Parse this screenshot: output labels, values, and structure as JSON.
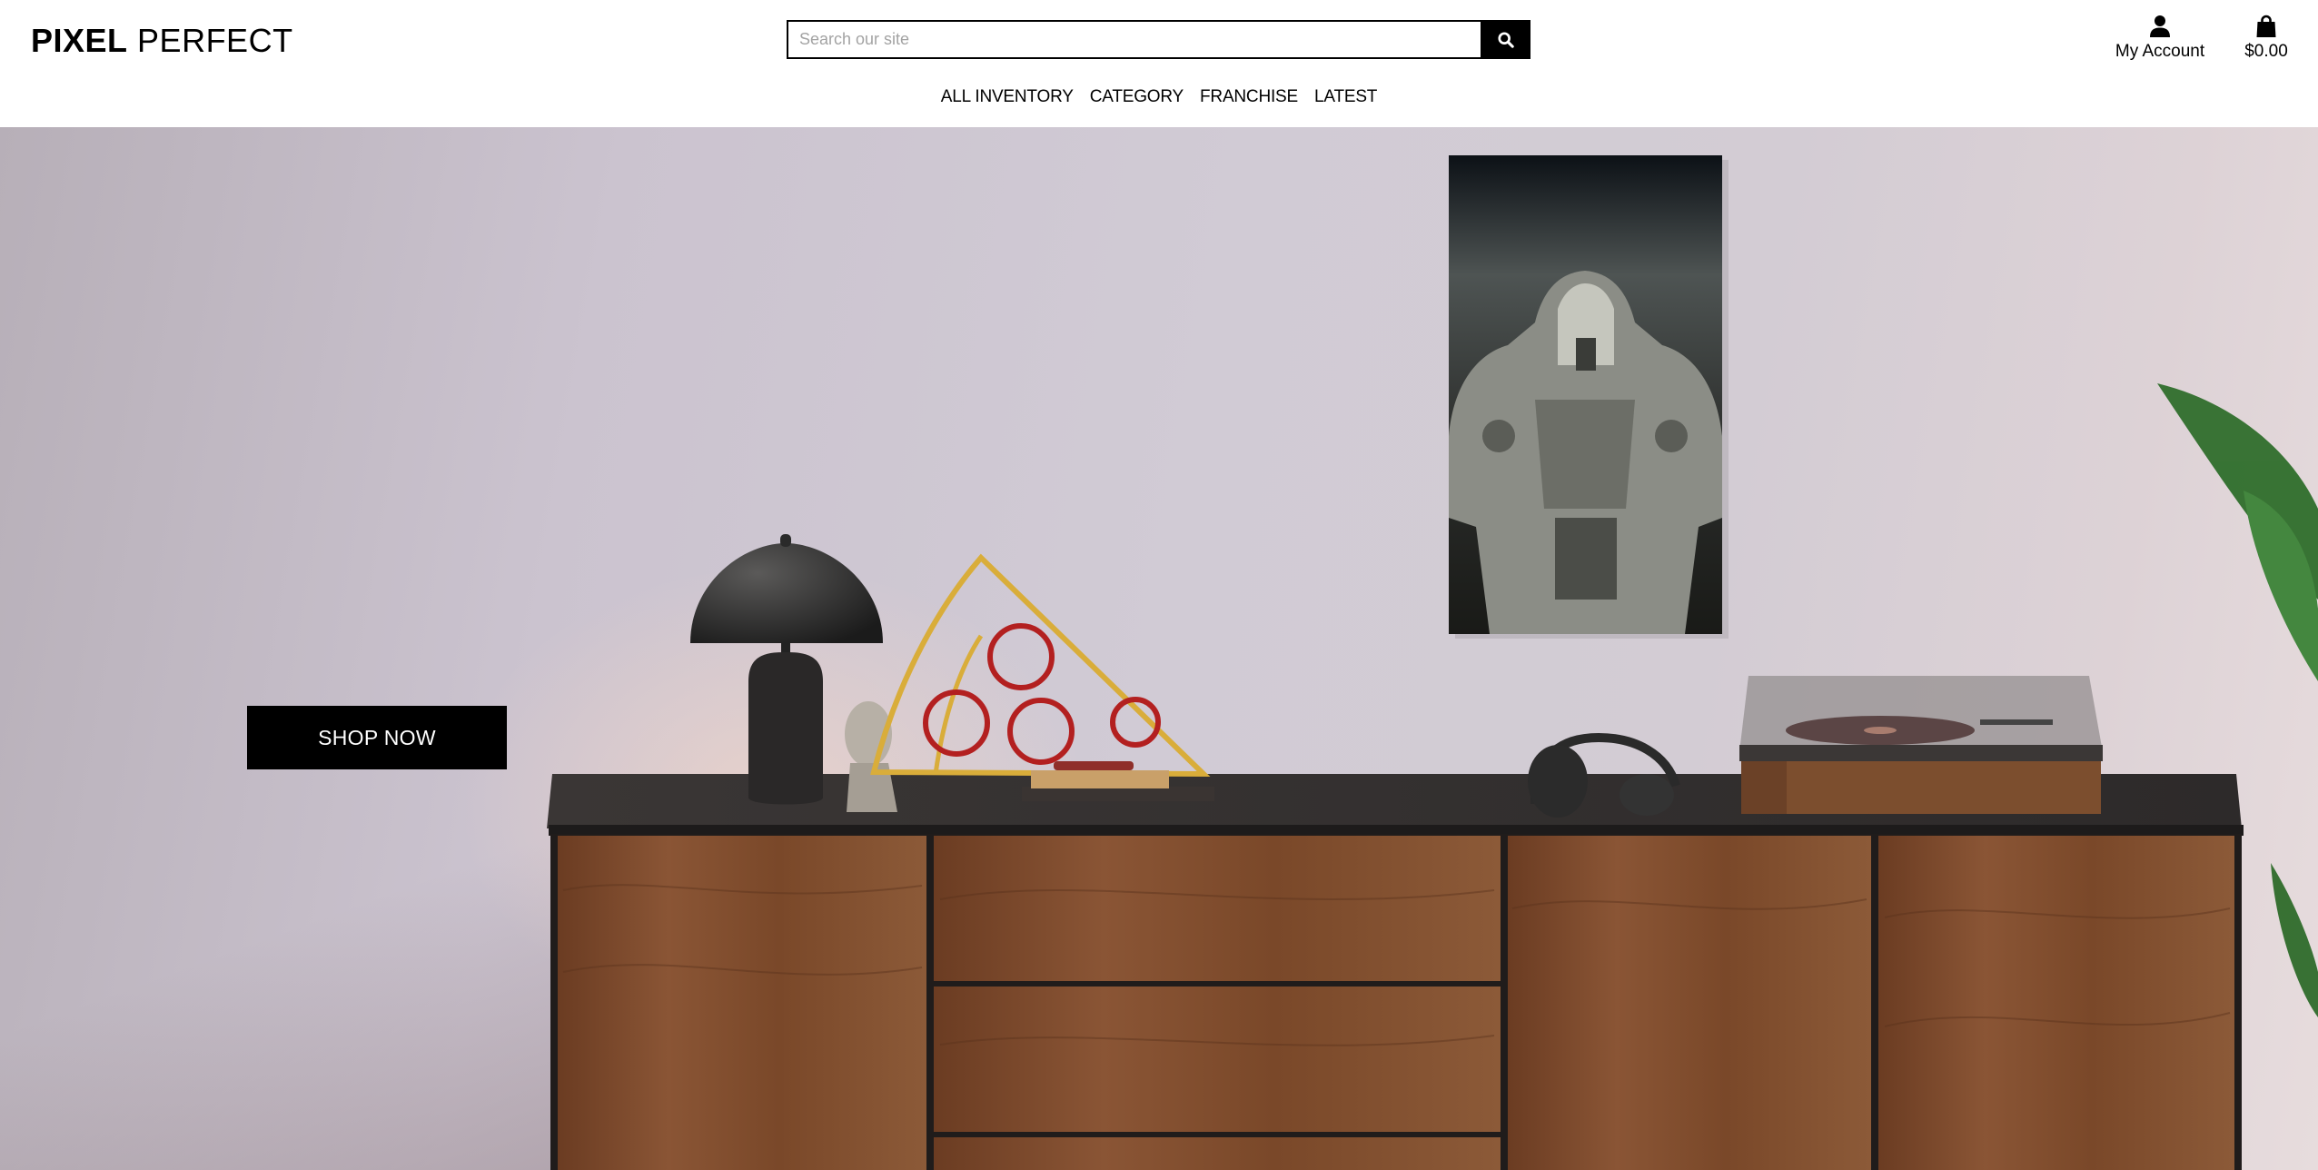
{
  "header": {
    "brand_bold": "PIXEL",
    "brand_light": "PERFECT",
    "search_placeholder": "Search our site",
    "account_label": "My Account",
    "cart_total": "$0.00"
  },
  "nav": {
    "items": [
      {
        "label": "ALL INVENTORY"
      },
      {
        "label": "CATEGORY"
      },
      {
        "label": "FRANCHISE"
      },
      {
        "label": "LATEST"
      }
    ]
  },
  "hero": {
    "cta_label": "SHOP NOW",
    "image": "living-room-sideboard-with-framed-power-armor-poster"
  },
  "icons": {
    "search": "search-icon",
    "account": "user-icon",
    "cart": "shopping-bag-icon"
  },
  "colors": {
    "primary": "#000000",
    "background": "#ffffff",
    "wall": "#d1cbd5",
    "wood": "#7a4a2c"
  }
}
